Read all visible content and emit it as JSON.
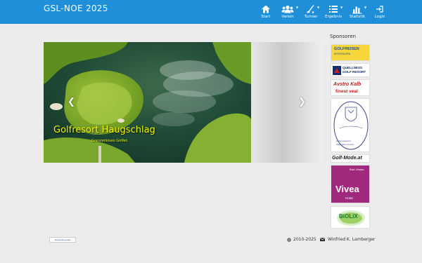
{
  "app": {
    "title": "GSL-NOE 2025"
  },
  "nav": [
    {
      "label": "Start",
      "icon": "home-icon",
      "dropdown": false
    },
    {
      "label": "Verein",
      "icon": "users-icon",
      "dropdown": true
    },
    {
      "label": "Turnier",
      "icon": "golf-club-icon",
      "dropdown": true
    },
    {
      "label": "Ergebnis",
      "icon": "list-icon",
      "dropdown": true
    },
    {
      "label": "Statistik",
      "icon": "bar-chart-icon",
      "dropdown": true
    },
    {
      "label": "Login",
      "icon": "login-icon",
      "dropdown": false
    }
  ],
  "carousel": {
    "caption_title": "Golfresort Haugschlag",
    "caption_subtitle": "Grenzenloses Golfen",
    "indicator_count": 10,
    "active_index": 0,
    "prev_icon": "chevron-left-icon",
    "next_icon": "chevron-right-icon"
  },
  "sponsors": {
    "title": "Sponsoren",
    "items": [
      {
        "name": "GOLFREISEN",
        "tagline": "SPORTALPEN"
      },
      {
        "name": "QUELLNESS",
        "tagline": "GOLF RESORT"
      },
      {
        "name": "Avstro Kalb",
        "tagline": "finest veal"
      },
      {
        "name": "Hohenmaierhof",
        "tagline": "Waldviertel Austria"
      },
      {
        "name": "Golf-Mode.at",
        "tagline": ""
      },
      {
        "name": "Vivea",
        "tagline": "Bad Vöslau",
        "sub": "Hotel"
      },
      {
        "name": "BiOLiX",
        "tagline": ""
      }
    ]
  },
  "footer": {
    "badge": "www.hbv.press",
    "copyright": "2010-2025",
    "copyright_icon": "copyright-icon",
    "author": "Winfried K. Lamberger",
    "author_icon": "envelope-icon"
  },
  "colors": {
    "navbar": "#1e8fd8",
    "caption": "#f2f204",
    "background": "#ececec"
  }
}
